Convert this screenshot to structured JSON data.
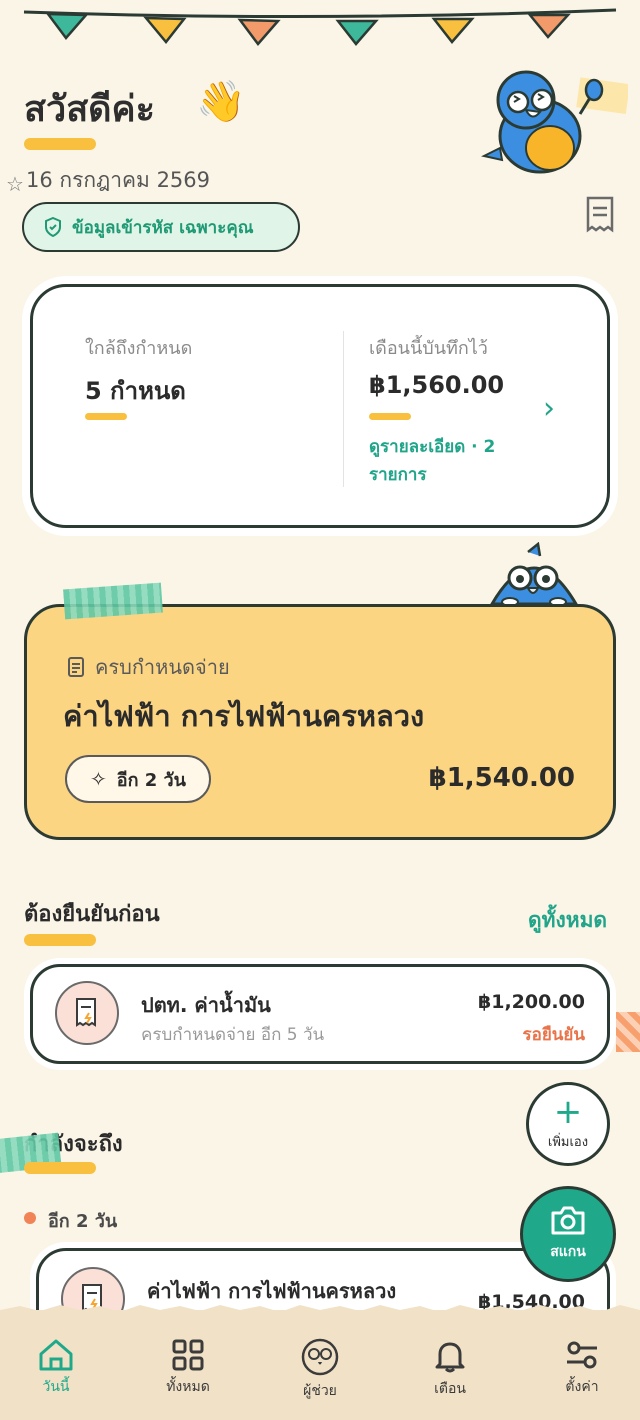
{
  "colors": {
    "background": "#FBF5E8",
    "accent": "#1FA98A",
    "featured_card": "#FCD582",
    "highlight_bar": "#F8C03E",
    "status_warning": "#E9744A"
  },
  "header": {
    "greeting": "สวัสดีค่ะ",
    "greeting_emoji": "👋",
    "date": "16 กรกฎาคม 2569",
    "privacy_badge": "ข้อมูลเข้ารหัส เฉพาะคุณ"
  },
  "summary": {
    "due_label": "ใกล้ถึงกำหนด",
    "due_value": "5 กำหนด",
    "month_label": "เดือนนี้บันทึกไว้",
    "month_value": "฿1,560.00",
    "details_link": "ดูรายละเอียด · 2 รายการ"
  },
  "featured": {
    "label": "ครบกำหนดจ่าย",
    "title": "ค่าไฟฟ้า การไฟฟ้านครหลวง",
    "days": "อีก 2 วัน",
    "amount": "฿1,540.00"
  },
  "confirm_section": {
    "title": "ต้องยืนยันก่อน",
    "see_all": "ดูทั้งหมด",
    "items": [
      {
        "name": "ปตท. ค่าน้ำมัน",
        "sub": "ครบกำหนดจ่าย อีก 5 วัน",
        "amount": "฿1,200.00",
        "status": "รอยืนยัน"
      }
    ]
  },
  "upcoming_section": {
    "title": "กำลังจะถึง",
    "group_label": "อีก 2 วัน",
    "items": [
      {
        "name": "ค่าไฟฟ้า การไฟฟ้านครหลวง",
        "amount": "฿1,540.00"
      }
    ]
  },
  "fab": {
    "add_label": "เพิ่มเอง",
    "scan_label": "สแกน"
  },
  "nav": {
    "items": [
      {
        "label": "วันนี้",
        "icon": "home-icon",
        "active": true
      },
      {
        "label": "ทั้งหมด",
        "icon": "grid-icon",
        "active": false
      },
      {
        "label": "ผู้ช่วย",
        "icon": "parrot-icon",
        "active": false
      },
      {
        "label": "เตือน",
        "icon": "bell-icon",
        "active": false
      },
      {
        "label": "ตั้งค่า",
        "icon": "sliders-icon",
        "active": false
      }
    ]
  }
}
